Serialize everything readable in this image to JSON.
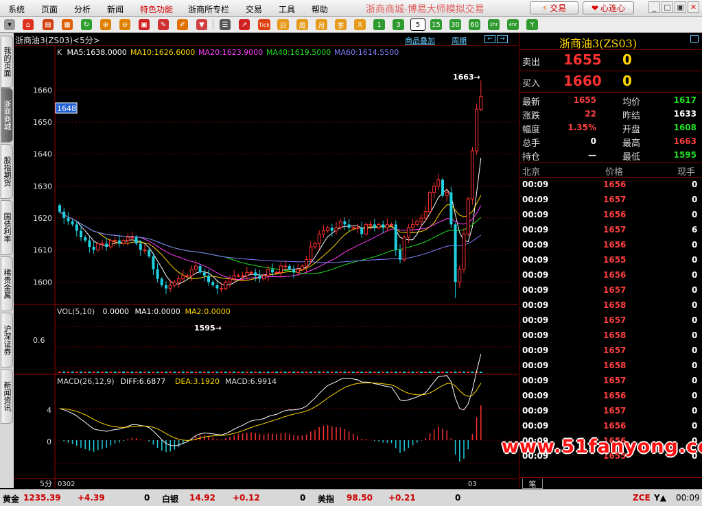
{
  "menu": [
    "系统",
    "页面",
    "分析",
    "新闻",
    "特色功能",
    "浙商所专栏",
    "交易",
    "工具",
    "帮助"
  ],
  "app_title": "浙商商城-博易大师模拟交易",
  "top_buttons": {
    "trade": "交易",
    "heart": "心连心"
  },
  "toolbar": {
    "tick_label": "Tick",
    "period_labels": [
      "日",
      "周",
      "月",
      "季",
      "X",
      "1",
      "3",
      "5",
      "15",
      "30",
      "60",
      "2hr",
      "4hr",
      "Y"
    ],
    "selected_period": "5"
  },
  "side_tabs": [
    "我的页面",
    "浙商商城",
    "股指期货",
    "国债利率",
    "稀贵金属",
    "沪深证券",
    "新闻资讯"
  ],
  "side_tab_active": 1,
  "chart": {
    "title": "浙商油3(ZS03)<5分>",
    "links": [
      "商品叠加",
      "周期"
    ],
    "ma_legend": [
      {
        "text": "K",
        "color": "#dddddd"
      },
      {
        "text": "MA5:1638.0000",
        "color": "#ffffff"
      },
      {
        "text": "MA10:1626.6000",
        "color": "#ffd700"
      },
      {
        "text": "MA20:1623.9000",
        "color": "#ff40ff"
      },
      {
        "text": "MA40:1619.5000",
        "color": "#20e020"
      },
      {
        "text": "MA60:1614.5500",
        "color": "#8080ff"
      }
    ],
    "vol_legend": [
      {
        "text": "VOL(5,10)",
        "color": "#dddddd"
      },
      {
        "text": "0.0000",
        "color": "#ffffff"
      },
      {
        "text": "MA1:0.0000",
        "color": "#ffffff"
      },
      {
        "text": "MA2:0.0000",
        "color": "#ffd700"
      }
    ],
    "macd_legend": [
      {
        "text": "MACD(26,12,9)",
        "color": "#dddddd"
      },
      {
        "text": "DIFF:6.6877",
        "color": "#ffffff"
      },
      {
        "text": "DEA:3.1920",
        "color": "#ffd700"
      },
      {
        "text": "MACD:6.9914",
        "color": "#dddddd"
      }
    ],
    "price_ticks": [
      "1660",
      "1650",
      "1640",
      "1630",
      "1620",
      "1610",
      "1600"
    ],
    "vol_tick": "0.6",
    "macd_ticks": [
      "4",
      "0"
    ],
    "current_price_tag": "1648",
    "high_annotation": "1663→",
    "low_annotation": "1595→",
    "period_label": "5分",
    "date_start": "0302",
    "date_end": "03"
  },
  "chart_data": {
    "type": "candlestick",
    "title": "浙商油3(ZS03)<5分>",
    "ylim": [
      1593,
      1668
    ],
    "y_ticks": [
      1600,
      1610,
      1620,
      1630,
      1640,
      1650,
      1660
    ],
    "current_price": 1648,
    "high": 1663,
    "low": 1595,
    "closes": [
      1622,
      1620,
      1619,
      1618,
      1616,
      1614,
      1613,
      1611,
      1610,
      1612,
      1612,
      1611,
      1613,
      1613,
      1612,
      1613,
      1614,
      1614,
      1612,
      1610,
      1610,
      1608,
      1604,
      1601,
      1599,
      1598,
      1599,
      1600,
      1601,
      1602,
      1602,
      1604,
      1605,
      1603,
      1602,
      1600,
      1599,
      1598,
      1598,
      1600,
      1601,
      1602,
      1602,
      1602,
      1603,
      1603,
      1602,
      1601,
      1602,
      1604,
      1603,
      1603,
      1605,
      1605,
      1604,
      1603,
      1604,
      1605,
      1607,
      1611,
      1612,
      1615,
      1616,
      1617,
      1616,
      1617,
      1619,
      1618,
      1617,
      1617,
      1617,
      1615,
      1618,
      1618,
      1617,
      1618,
      1617,
      1618,
      1618,
      1610,
      1607,
      1614,
      1617,
      1618,
      1619,
      1620,
      1622,
      1628,
      1630,
      1632,
      1627,
      1628,
      1618,
      1600,
      1604,
      1615,
      1626,
      1641,
      1654,
      1658
    ],
    "series": [
      {
        "name": "MA5",
        "color": "#ffffff"
      },
      {
        "name": "MA10",
        "color": "#ffd700"
      },
      {
        "name": "MA20",
        "color": "#ff40ff"
      },
      {
        "name": "MA40",
        "color": "#20e020"
      },
      {
        "name": "MA60",
        "color": "#8080ff"
      }
    ]
  },
  "quote": {
    "title": "浙商油3(ZS03)",
    "sell": {
      "label": "卖出",
      "price": "1655",
      "vol": "0"
    },
    "buy": {
      "label": "买入",
      "price": "1660",
      "vol": "0"
    },
    "stats": [
      {
        "label": "最新",
        "value": "1655",
        "color": "red",
        "label2": "均价",
        "value2": "1617",
        "color2": "green"
      },
      {
        "label": "涨跌",
        "value": "22",
        "color": "red",
        "label2": "昨结",
        "value2": "1633",
        "color2": "white"
      },
      {
        "label": "幅度",
        "value": "1.35%",
        "color": "red",
        "label2": "开盘",
        "value2": "1608",
        "color2": "green"
      },
      {
        "label": "总手",
        "value": "0",
        "color": "white",
        "label2": "最高",
        "value2": "1663",
        "color2": "red"
      },
      {
        "label": "持仓",
        "value": "—",
        "color": "white",
        "label2": "最低",
        "value2": "1595",
        "color2": "green"
      }
    ],
    "tick_header": {
      "time": "北京",
      "price": "价格",
      "vol": "现手"
    },
    "ticks": [
      {
        "time": "00:09",
        "price": "1656",
        "vol": "0"
      },
      {
        "time": "00:09",
        "price": "1657",
        "vol": "0"
      },
      {
        "time": "00:09",
        "price": "1656",
        "vol": "0"
      },
      {
        "time": "00:09",
        "price": "1657",
        "vol": "6"
      },
      {
        "time": "00:09",
        "price": "1656",
        "vol": "0"
      },
      {
        "time": "00:09",
        "price": "1655",
        "vol": "0"
      },
      {
        "time": "00:09",
        "price": "1656",
        "vol": "0"
      },
      {
        "time": "00:09",
        "price": "1657",
        "vol": "0"
      },
      {
        "time": "00:09",
        "price": "1658",
        "vol": "0"
      },
      {
        "time": "00:09",
        "price": "1657",
        "vol": "0"
      },
      {
        "time": "00:09",
        "price": "1658",
        "vol": "0"
      },
      {
        "time": "00:09",
        "price": "1657",
        "vol": "0"
      },
      {
        "time": "00:09",
        "price": "1658",
        "vol": "0"
      },
      {
        "time": "00:09",
        "price": "1657",
        "vol": "0"
      },
      {
        "time": "00:09",
        "price": "1656",
        "vol": "0"
      },
      {
        "time": "00:09",
        "price": "1657",
        "vol": "0"
      },
      {
        "time": "00:09",
        "price": "1656",
        "vol": "0"
      },
      {
        "time": "00:09",
        "price": "1656",
        "vol": "0"
      },
      {
        "time": "00:09",
        "price": "1655",
        "vol": "0"
      }
    ],
    "tab_label": "笔"
  },
  "status": {
    "gold_label": "黄金",
    "gold_price": "1235.39",
    "gold_change": "+4.39",
    "gold_vol": "0",
    "silver_label": "白银",
    "silver_price": "14.92",
    "silver_change": "+0.12",
    "silver_vol": "0",
    "usd_label": "美指",
    "usd_price": "98.50",
    "usd_change": "+0.21",
    "usd_vol": "0",
    "exchange": "ZCE",
    "time": "00:09"
  },
  "watermark": "www.51fanyong.com"
}
